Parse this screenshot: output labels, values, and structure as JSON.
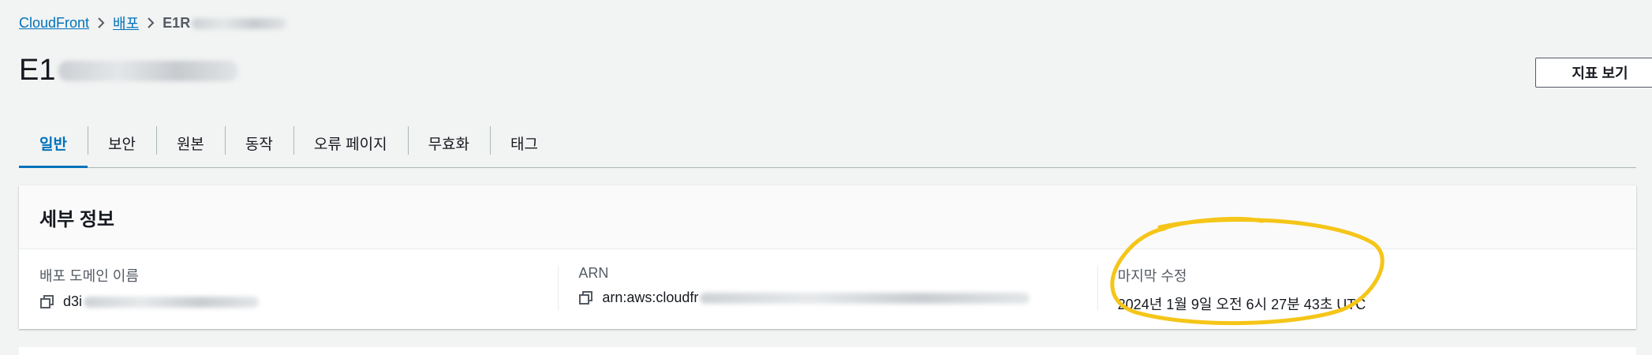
{
  "breadcrumb": {
    "items": [
      "CloudFront",
      "배포"
    ],
    "current": "E1R"
  },
  "page": {
    "title": "E1"
  },
  "header_actions": {
    "metrics_label": "지표 보기"
  },
  "tabs": [
    {
      "label": "일반",
      "active": true
    },
    {
      "label": "보안"
    },
    {
      "label": "원본"
    },
    {
      "label": "동작"
    },
    {
      "label": "오류 페이지"
    },
    {
      "label": "무효화"
    },
    {
      "label": "태그"
    }
  ],
  "details": {
    "title": "세부 정보",
    "domain": {
      "label": "배포 도메인 이름",
      "value": "d3i"
    },
    "arn": {
      "label": "ARN",
      "value": "arn:aws:cloudfr"
    },
    "modified": {
      "label": "마지막 수정",
      "value": "2024년 1월 9일 오전 6시 27분 43초 UTC"
    }
  },
  "colors": {
    "accent": "#0073bb",
    "highlight": "#f5c518"
  },
  "icons": {
    "separator": "chevron-right-icon",
    "copy": "copy-icon"
  }
}
